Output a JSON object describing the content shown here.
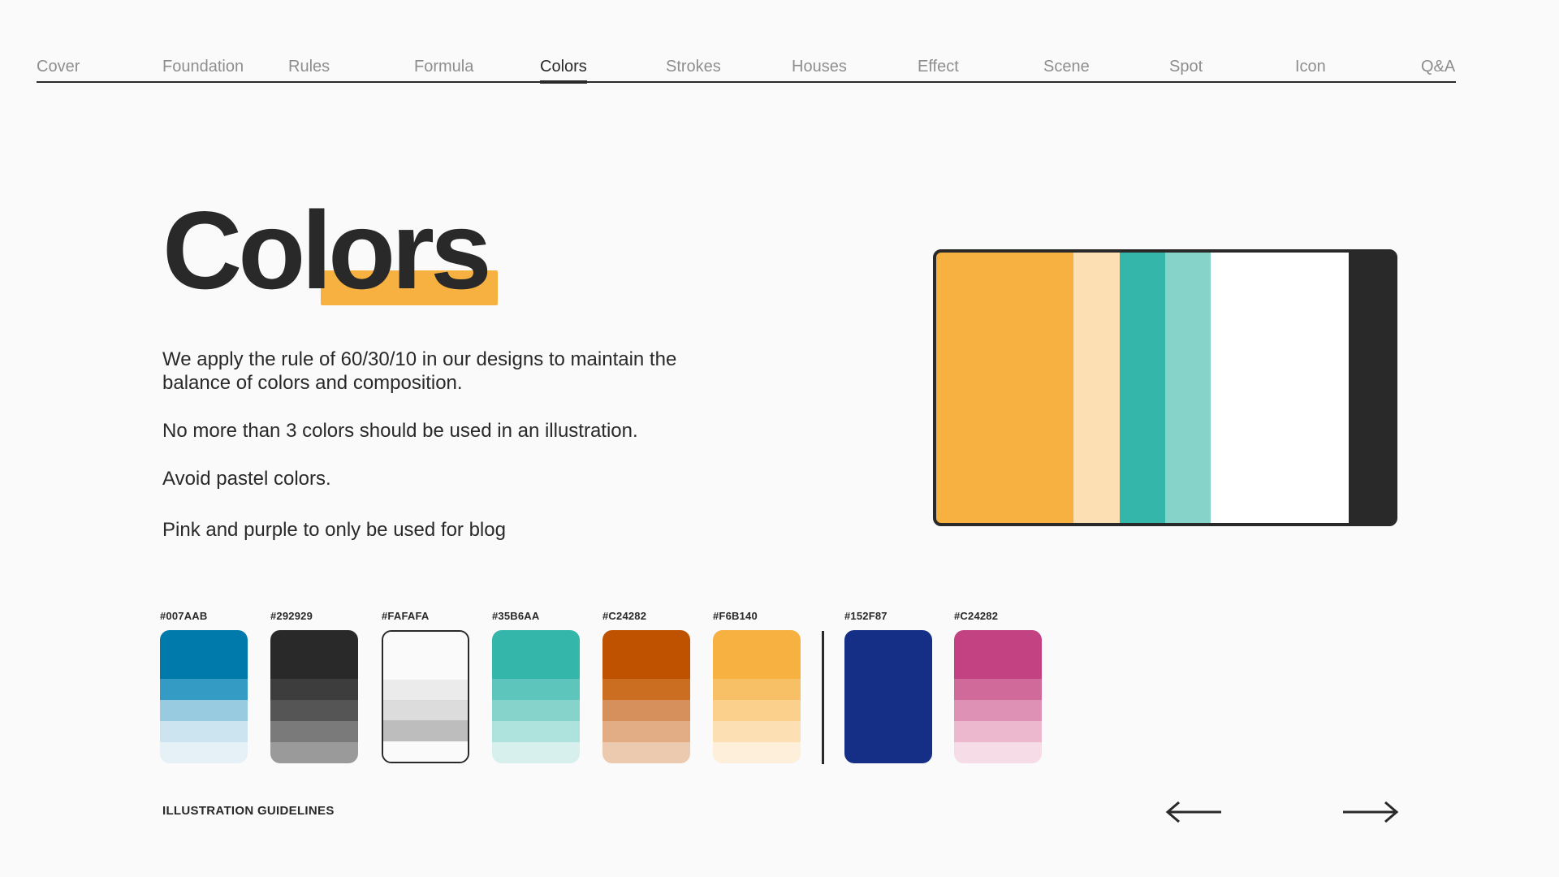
{
  "nav": {
    "items": [
      "Cover",
      "Foundation",
      "Rules",
      "Formula",
      "Colors",
      "Strokes",
      "Houses",
      "Effect",
      "Scene",
      "Spot",
      "Icon",
      "Q&A"
    ],
    "active_index": 4
  },
  "title": "Colors",
  "paragraphs": [
    "We apply the rule of 60/30/10 in our designs to maintain the balance of colors and composition.",
    "No more than 3 colors should be used in an illustration.",
    "Avoid pastel colors.",
    "Pink and purple to only be used for blog"
  ],
  "palette_ratio": {
    "segments": [
      {
        "color": "#F6B140",
        "share": 0.3
      },
      {
        "color": "#FCE0B3",
        "share": 0.1
      },
      {
        "color": "#35B6AA",
        "share": 0.1
      },
      {
        "color": "#86D3C9",
        "share": 0.1
      },
      {
        "color": "#FFFFFF",
        "share": 0.3
      },
      {
        "color": "#292929",
        "share": 0.1
      }
    ]
  },
  "swatches": [
    {
      "label": "#007AAB",
      "shades": [
        "#007AAB",
        "#339BC4",
        "#99CBE0",
        "#CCE4EF",
        "#E5F1F7"
      ]
    },
    {
      "label": "#292929",
      "shades": [
        "#292929",
        "#3D3D3D",
        "#555555",
        "#7A7A7A",
        "#9A9A9A"
      ]
    },
    {
      "label": "#FAFAFA",
      "shades": [
        "#FAFAFA",
        "#EBEBEB",
        "#DCDCDC",
        "#BDBDBD",
        "#FAFAFA"
      ],
      "bordered": true
    },
    {
      "label": "#35B6AA",
      "shades": [
        "#35B6AA",
        "#5DC5BB",
        "#86D3CB",
        "#AEE2DC",
        "#D7F0ED"
      ]
    },
    {
      "label": "#C24282",
      "shades": [
        "#BF5200",
        "#CC6E22",
        "#D6905C",
        "#E2AD85",
        "#ECCAAF"
      ]
    },
    {
      "label": "#F6B140",
      "shades": [
        "#F6B140",
        "#F8C066",
        "#FAD08C",
        "#FCE0B3",
        "#FDEFD9"
      ]
    },
    {
      "label": "#152F87",
      "shades": [
        "#152F87",
        "#152F87",
        "#152F87",
        "#152F87",
        "#152F87"
      ]
    },
    {
      "label": "#C24282",
      "shades": [
        "#C24282",
        "#D06A9B",
        "#DE91B5",
        "#EBB8CE",
        "#F5DCE7"
      ]
    }
  ],
  "footer": {
    "label": "ILLUSTRATION GUIDELINES"
  },
  "icons": {
    "prev": "arrow-left-icon",
    "next": "arrow-right-icon"
  },
  "colors": {
    "text": "#292929",
    "muted_nav": "#8E8E8E",
    "accent": "#F6B140",
    "background": "#FAFAFA"
  }
}
